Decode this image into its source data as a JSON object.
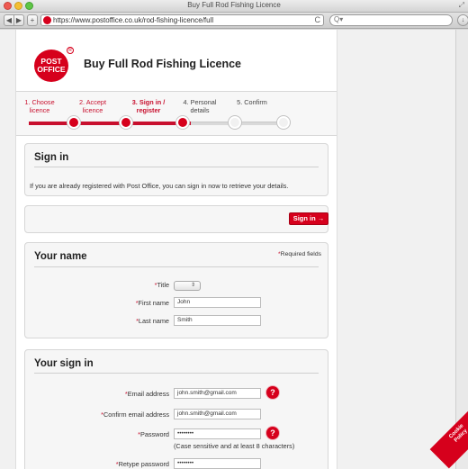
{
  "window": {
    "title": "Buy Full Rod Fishing Licence",
    "url": "https://www.postoffice.co.uk/rod-fishing-licence/full"
  },
  "toolbar": {
    "back": "◀",
    "forward": "▶",
    "add": "+",
    "reload": "C",
    "search_icon": "Q▾"
  },
  "header": {
    "logo_line1": "POST",
    "logo_line2": "OFFICE",
    "logo_mark": "R",
    "title": "Buy Full Rod Fishing Licence"
  },
  "steps": [
    {
      "line1": "1. Choose",
      "line2": "licence",
      "state": "done"
    },
    {
      "line1": "2. Accept",
      "line2": "licence",
      "state": "done"
    },
    {
      "line1": "3. Sign in /",
      "line2": "register",
      "state": "current"
    },
    {
      "line1": "4. Personal",
      "line2": "details",
      "state": "future"
    },
    {
      "line1": "5. Confirm",
      "line2": "",
      "state": "future"
    }
  ],
  "signin": {
    "heading": "Sign in",
    "text": "If you are already registered with Post Office, you can sign in now to retrieve your details.",
    "button": "Sign in →"
  },
  "your_name": {
    "heading": "Your name",
    "required_star": "*",
    "required_text": "Required fields",
    "title_label": "Title",
    "first_name_label": "First name",
    "first_name_value": "John",
    "last_name_label": "Last name",
    "last_name_value": "Smith"
  },
  "your_signin": {
    "heading": "Your sign in",
    "email_label": "Email address",
    "email_value": "john.smith@gmail.com",
    "confirm_email_label": "Confirm email address",
    "confirm_email_value": "john.smith@gmail.com",
    "password_label": "Password",
    "password_value": "••••••••",
    "password_hint": "(Case sensitive and at least 8 characters)",
    "retype_password_label": "Retype password",
    "retype_password_value": "••••••••",
    "help": "?"
  },
  "cookie": {
    "line1": "Cookie",
    "line2": "Policy"
  }
}
